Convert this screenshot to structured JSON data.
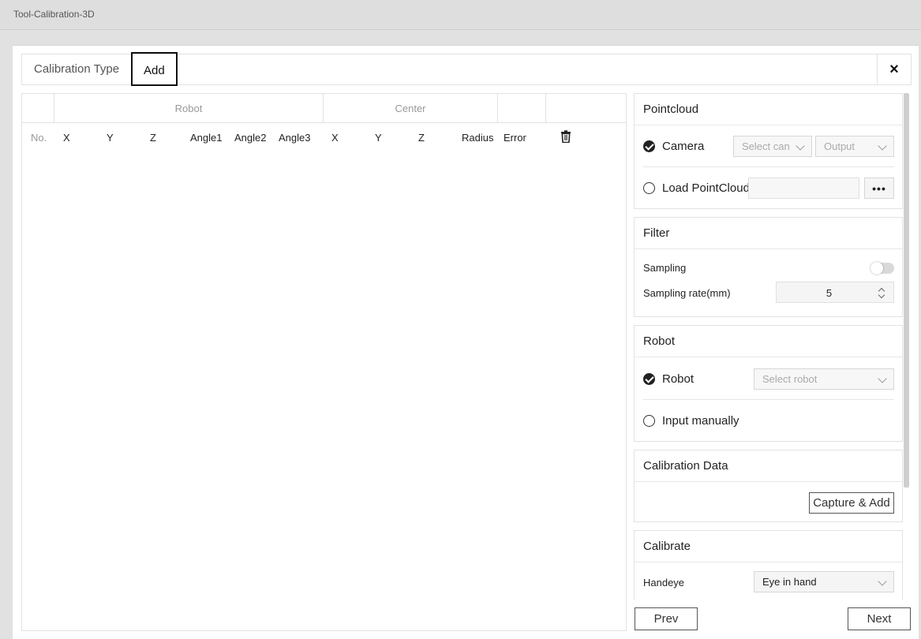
{
  "window": {
    "title": "Tool-Calibration-3D"
  },
  "tabs": [
    {
      "label": "Calibration Type"
    },
    {
      "label": "Add"
    }
  ],
  "close_symbol": "×",
  "table": {
    "groups": {
      "robot": "Robot",
      "center": "Center"
    },
    "columns": [
      "No.",
      "X",
      "Y",
      "Z",
      "Angle1",
      "Angle2",
      "Angle3",
      "X",
      "Y",
      "Z",
      "Radius",
      "Error"
    ],
    "delete_icon": "trash-icon",
    "rows": []
  },
  "pointcloud": {
    "title": "Pointcloud",
    "camera_label": "Camera",
    "camera_checked": true,
    "camera_select": "Select can",
    "output_select": "Output",
    "load_label": "Load PointCloud",
    "load_path": "",
    "browse_label": "•••"
  },
  "filter": {
    "title": "Filter",
    "sampling_label": "Sampling",
    "sampling_enabled": false,
    "rate_label": "Sampling rate(mm)",
    "rate_value": "5"
  },
  "robot": {
    "title": "Robot",
    "robot_label": "Robot",
    "robot_checked": true,
    "robot_select": "Select robot",
    "manual_label": "Input manually"
  },
  "calibration_data": {
    "title": "Calibration Data",
    "capture_label": "Capture & Add"
  },
  "calibrate": {
    "title": "Calibrate",
    "handeye_label": "Handeye",
    "handeye_value": "Eye in hand"
  },
  "footer": {
    "prev_label": "Prev",
    "next_label": "Next"
  },
  "colors": {
    "accent": "#111111",
    "border": "#e2e2e2",
    "muted": "#999999"
  }
}
